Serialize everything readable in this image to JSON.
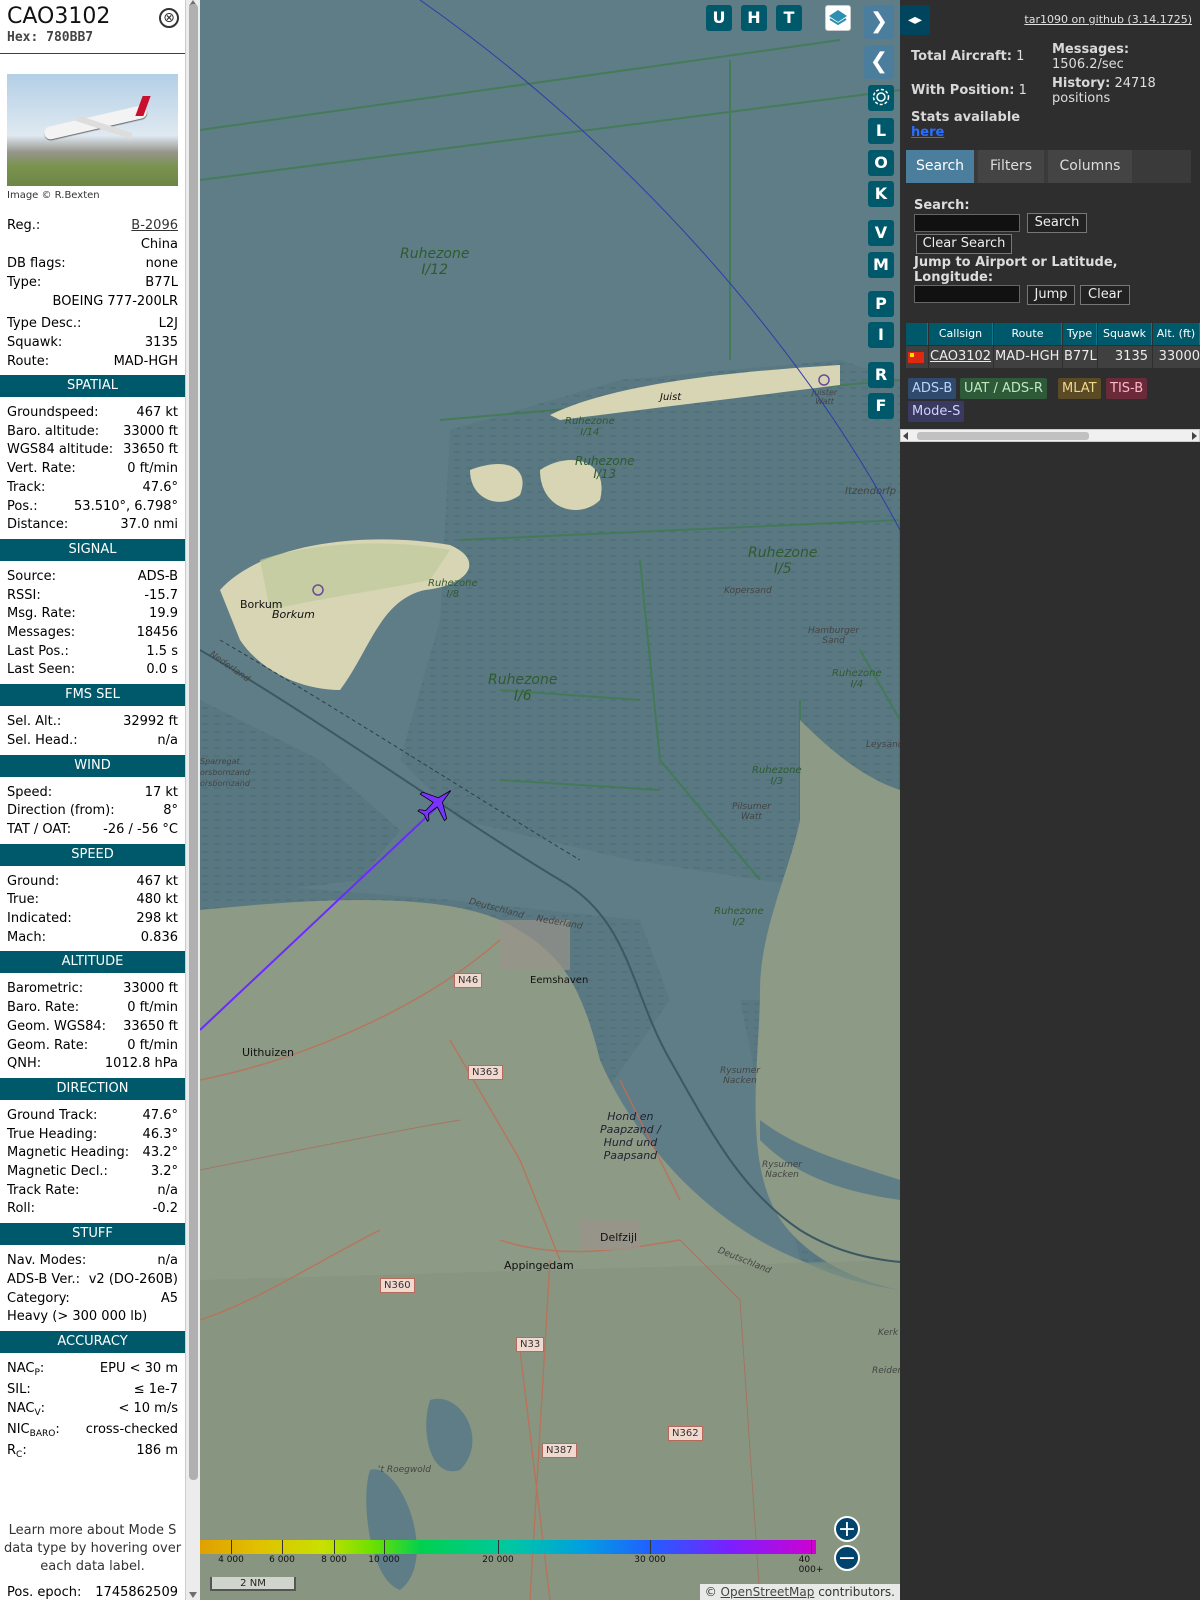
{
  "aircraft": {
    "callsign": "CAO3102",
    "hex": "Hex: 780BB7",
    "close_glyph": "⊗",
    "photo_credit": "Image © R.Bexten"
  },
  "basic": [
    {
      "label": "Reg.:",
      "value": "B-2096",
      "link": true
    },
    {
      "label": "",
      "value": "China"
    },
    {
      "label": "DB flags:",
      "value": "none"
    },
    {
      "label": "Type:",
      "value": "B77L"
    },
    {
      "label": "",
      "value": "BOEING 777-200LR"
    },
    {
      "label": "Type Desc.:",
      "value": "L2J"
    },
    {
      "label": "Squawk:",
      "value": "3135"
    },
    {
      "label": "Route:",
      "value": "MAD-HGH"
    }
  ],
  "sections": [
    {
      "title": "SPATIAL",
      "rows": [
        {
          "label": "Groundspeed:",
          "value": "467 kt"
        },
        {
          "label": "Baro. altitude:",
          "value": "33000 ft"
        },
        {
          "label": "WGS84 altitude:",
          "value": "33650 ft"
        },
        {
          "label": "Vert. Rate:",
          "value": "0 ft/min"
        },
        {
          "label": "Track:",
          "value": "47.6°"
        },
        {
          "label": "Pos.:",
          "value": "53.510°, 6.798°"
        },
        {
          "label": "Distance:",
          "value": "37.0 nmi"
        }
      ]
    },
    {
      "title": "SIGNAL",
      "rows": [
        {
          "label": "Source:",
          "value": "ADS-B"
        },
        {
          "label": "RSSI:",
          "value": "-15.7"
        },
        {
          "label": "Msg. Rate:",
          "value": "19.9"
        },
        {
          "label": "Messages:",
          "value": "18456"
        },
        {
          "label": "Last Pos.:",
          "value": "1.5 s"
        },
        {
          "label": "Last Seen:",
          "value": "0.0 s"
        }
      ]
    },
    {
      "title": "FMS SEL",
      "rows": [
        {
          "label": "Sel. Alt.:",
          "value": "32992 ft"
        },
        {
          "label": "Sel. Head.:",
          "value": "n/a"
        }
      ]
    },
    {
      "title": "WIND",
      "rows": [
        {
          "label": "Speed:",
          "value": "17 kt"
        },
        {
          "label": "Direction (from):",
          "value": "8°"
        },
        {
          "label": "TAT / OAT:",
          "value": "-26 / -56 °C"
        }
      ]
    },
    {
      "title": "SPEED",
      "rows": [
        {
          "label": "Ground:",
          "value": "467 kt"
        },
        {
          "label": "True:",
          "value": "480 kt"
        },
        {
          "label": "Indicated:",
          "value": "298 kt"
        },
        {
          "label": "Mach:",
          "value": "0.836"
        }
      ]
    },
    {
      "title": "ALTITUDE",
      "rows": [
        {
          "label": "Barometric:",
          "value": "33000 ft"
        },
        {
          "label": "Baro. Rate:",
          "value": "0 ft/min"
        },
        {
          "label": "Geom. WGS84:",
          "value": "33650 ft"
        },
        {
          "label": "Geom. Rate:",
          "value": "0 ft/min"
        },
        {
          "label": "QNH:",
          "value": "1012.8 hPa"
        }
      ]
    },
    {
      "title": "DIRECTION",
      "rows": [
        {
          "label": "Ground Track:",
          "value": "47.6°"
        },
        {
          "label": "True Heading:",
          "value": "46.3°"
        },
        {
          "label": "Magnetic Heading:",
          "value": "43.2°"
        },
        {
          "label": "Magnetic Decl.:",
          "value": "3.2°"
        },
        {
          "label": "Track Rate:",
          "value": "n/a"
        },
        {
          "label": "Roll:",
          "value": "-0.2"
        }
      ]
    },
    {
      "title": "STUFF",
      "rows": [
        {
          "label": "Nav. Modes:",
          "value": "n/a"
        },
        {
          "label": "ADS-B Ver.:",
          "value": "v2 (DO-260B)"
        },
        {
          "label": "Category:",
          "value": "A5"
        },
        {
          "label": "",
          "value": "Heavy (> 300 000 lb)",
          "align": "left"
        }
      ]
    },
    {
      "title": "ACCURACY",
      "rows": [
        {
          "label": "NAC",
          "sub": "P",
          "suffix": ":",
          "value": "EPU < 30 m"
        },
        {
          "label": "SIL:",
          "value": "≤ 1e-7"
        },
        {
          "label": "NAC",
          "sub": "V",
          "suffix": ":",
          "value": "< 10 m/s"
        },
        {
          "label": "NIC",
          "sub": "BARO",
          "suffix": ":",
          "value": "cross-checked"
        },
        {
          "label": "R",
          "sub": "C",
          "suffix": ":",
          "value": "186 m"
        }
      ]
    }
  ],
  "learn_more": "Learn more about Mode S data type by hovering over each data label.",
  "pos_epoch": {
    "label": "Pos. epoch:",
    "value": "1745862509"
  },
  "map": {
    "buttons_top": [
      "U",
      "H",
      "T"
    ],
    "buttons_side": [
      "L",
      "O",
      "K",
      "V",
      "M",
      "P",
      "I",
      "R",
      "F"
    ],
    "zones": [
      {
        "text": "Ruhezone\nI/12"
      },
      {
        "text": "Ruhezone\nI/14"
      },
      {
        "text": "Ruhezone\nI/13"
      },
      {
        "text": "Ruhezone\nI/5"
      },
      {
        "text": "Ruhezone\nI/6"
      },
      {
        "text": "Ruhezone\nI/8"
      },
      {
        "text": "Ruhezone\nI/4"
      },
      {
        "text": "Ruhezone\nI/3"
      },
      {
        "text": "Ruhezone\nI/2"
      }
    ],
    "places": [
      "Juist",
      "Borkum",
      "Borkum",
      "Eemshaven",
      "Uithuizen",
      "Delfzijl",
      "Appingedam",
      "Kopersand",
      "Hamburger\nSand",
      "Pilsumer\nWatt",
      "Hond en\nPaapzand /\nHund und\nPaapsand",
      "Rysumer\nNacken",
      "Rysumer\nNacken",
      "Nederland",
      "Deutschland",
      "Nederland",
      "Deutschland",
      "Itzendorfp",
      "Juister\nWatt",
      "Leysand",
      "Kerk",
      "Reiderpl",
      "Sparregat\norsbornzand\norsbornzand",
      "'t Roegwold"
    ],
    "roads": [
      "N46",
      "N363",
      "N360",
      "N33",
      "N387",
      "N362"
    ],
    "legend_ticks": [
      "4 000",
      "6 000",
      "8 000",
      "10 000",
      "20 000",
      "30 000",
      "40 000+"
    ],
    "scale": "2 NM",
    "attribution_prefix": "©",
    "attribution_link": "OpenStreetMap",
    "attribution_suffix": "contributors.",
    "zoom_in": "+",
    "zoom_out": "−"
  },
  "right": {
    "github": "tar1090 on github (3.14.1725)",
    "total_aircraft_label": "Total Aircraft:",
    "total_aircraft": "1",
    "with_position_label": "With Position:",
    "with_position": "1",
    "stats_label": "Stats available",
    "stats_link": "here",
    "messages_label": "Messages:",
    "messages_value": "1506.2/sec",
    "history_label": "History:",
    "history_value": "24718",
    "history_unit": "positions",
    "tabs": [
      "Search",
      "Filters",
      "Columns"
    ],
    "search_label": "Search:",
    "search_button": "Search",
    "clear_search_button": "Clear Search",
    "jump_label": "Jump to Airport or Latitude, Longitude:",
    "jump_button": "Jump",
    "clear_button": "Clear",
    "table": {
      "columns": [
        "Callsign",
        "Route",
        "Type",
        "Squawk",
        "Alt. (ft)"
      ],
      "rows": [
        [
          "CAO3102",
          "MAD-HGH",
          "B77L",
          "3135",
          "33000"
        ]
      ]
    },
    "badges": [
      {
        "text": "ADS-B",
        "bg": "#2f4a6d"
      },
      {
        "text": "UAT / ADS-R",
        "bg": "#2f5a3a"
      },
      {
        "text": "MLAT",
        "bg": "#5a4a25"
      },
      {
        "text": "TIS-B",
        "bg": "#6b2a3a"
      },
      {
        "text": "Mode-S",
        "bg": "#3a3a60"
      }
    ]
  }
}
